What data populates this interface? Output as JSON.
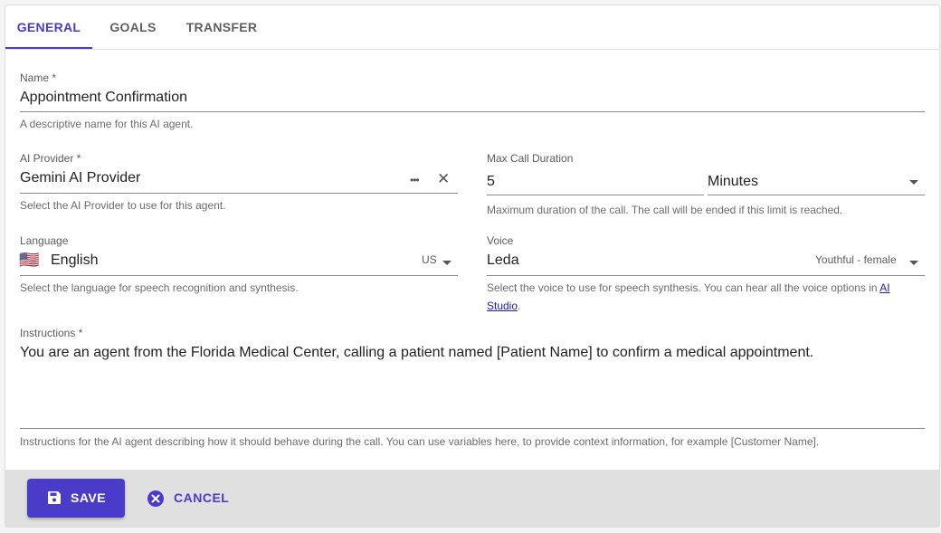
{
  "tabs": [
    "GENERAL",
    "GOALS",
    "TRANSFER"
  ],
  "name_field": {
    "label": "Name *",
    "value": "Appointment Confirmation",
    "hint": "A descriptive name for this AI agent."
  },
  "ai_provider": {
    "label": "AI Provider *",
    "value": "Gemini AI Provider",
    "more": "•••",
    "clear": "✕",
    "hint": "Select the AI Provider to use for this agent."
  },
  "max_call_duration": {
    "label": "Max Call Duration",
    "value": "5",
    "unit": "Minutes",
    "hint": "Maximum duration of the call. The call will be ended if this limit is reached."
  },
  "language": {
    "label": "Language",
    "flag": "🇺🇸",
    "value": "English",
    "region": "US",
    "hint": "Select the language for speech recognition and synthesis."
  },
  "voice": {
    "label": "Voice",
    "value": "Leda",
    "description": "Youthful - female",
    "hint_before": "Select the voice to use for speech synthesis. You can hear all the voice options in ",
    "hint_link_line1": "AI",
    "hint_link_line2": "Studio",
    "hint_after": "."
  },
  "instructions": {
    "label": "Instructions *",
    "value": "You are an agent from the Florida Medical Center, calling a patient named [Patient Name] to confirm a medical appointment.",
    "hint": "Instructions for the AI agent describing how it should behave during the call. You can use variables here, to provide context information, for example [Customer Name]."
  },
  "footer": {
    "save_label": "SAVE",
    "cancel_label": "CANCEL"
  },
  "colors": {
    "accent": "#4b3bc9",
    "footer_bg": "#e0e0e0"
  }
}
